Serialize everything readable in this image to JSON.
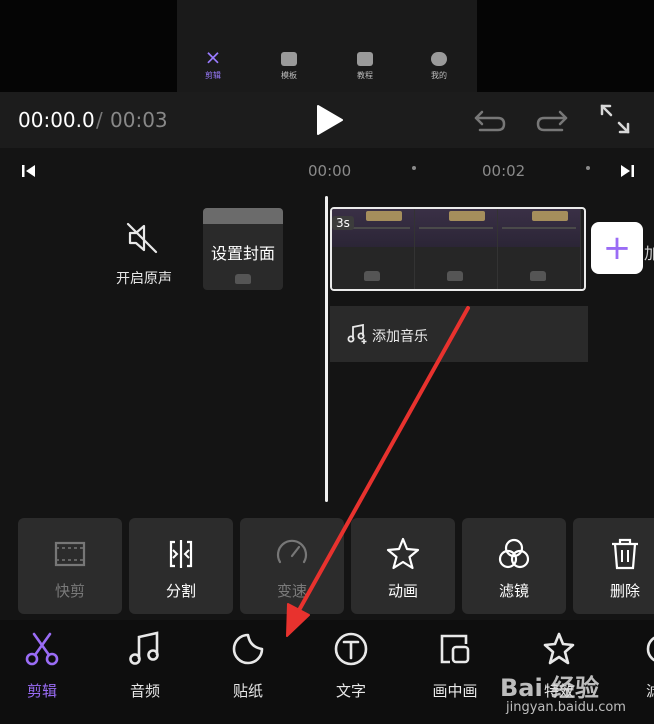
{
  "preview": {
    "tabs": [
      {
        "label": "剪辑",
        "active": true
      },
      {
        "label": "模板",
        "active": false
      },
      {
        "label": "教程",
        "active": false
      },
      {
        "label": "我的",
        "active": false
      }
    ]
  },
  "player": {
    "current_time": "00:00.0",
    "separator": "/",
    "total_time": "00:03"
  },
  "ruler": {
    "ticks": [
      "00:00",
      "00:02"
    ]
  },
  "track": {
    "original_sound_label": "开启原声",
    "cover_label": "设置封面",
    "clip_duration": "3s",
    "add_clip_symbol": "+",
    "add_clip_tail": "加",
    "add_music_label": "添加音乐"
  },
  "tools": [
    {
      "label": "快剪",
      "enabled": false
    },
    {
      "label": "分割",
      "enabled": true
    },
    {
      "label": "变速",
      "enabled": false
    },
    {
      "label": "动画",
      "enabled": true
    },
    {
      "label": "滤镜",
      "enabled": true
    },
    {
      "label": "删除",
      "enabled": true
    }
  ],
  "bottom_nav": [
    {
      "label": "剪辑",
      "active": true
    },
    {
      "label": "音频",
      "active": false
    },
    {
      "label": "贴纸",
      "active": false
    },
    {
      "label": "文字",
      "active": false
    },
    {
      "label": "画中画",
      "active": false
    },
    {
      "label": "特效",
      "active": false
    },
    {
      "label": "滤",
      "active": false
    }
  ],
  "watermark": {
    "logo": "Bai 经验",
    "site": "jingyan.baidu.com"
  },
  "colors": {
    "accent": "#9a6cf5",
    "annotation_arrow": "#e8322e",
    "background": "#141414"
  }
}
